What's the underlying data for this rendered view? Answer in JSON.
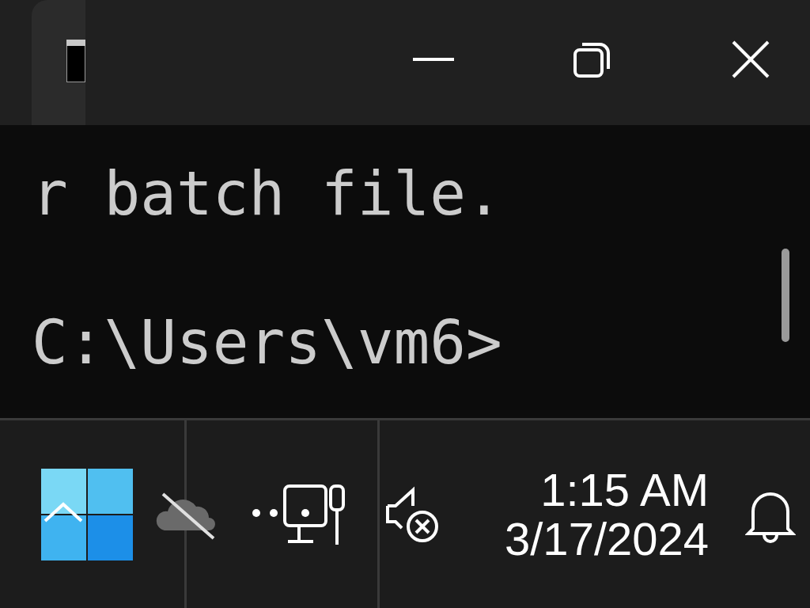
{
  "terminal": {
    "output_line": "r batch file.",
    "prompt": "C:\\Users\\vm6>"
  },
  "taskbar": {
    "clock": {
      "time": "1:15 AM",
      "date": "3/17/2024"
    }
  }
}
